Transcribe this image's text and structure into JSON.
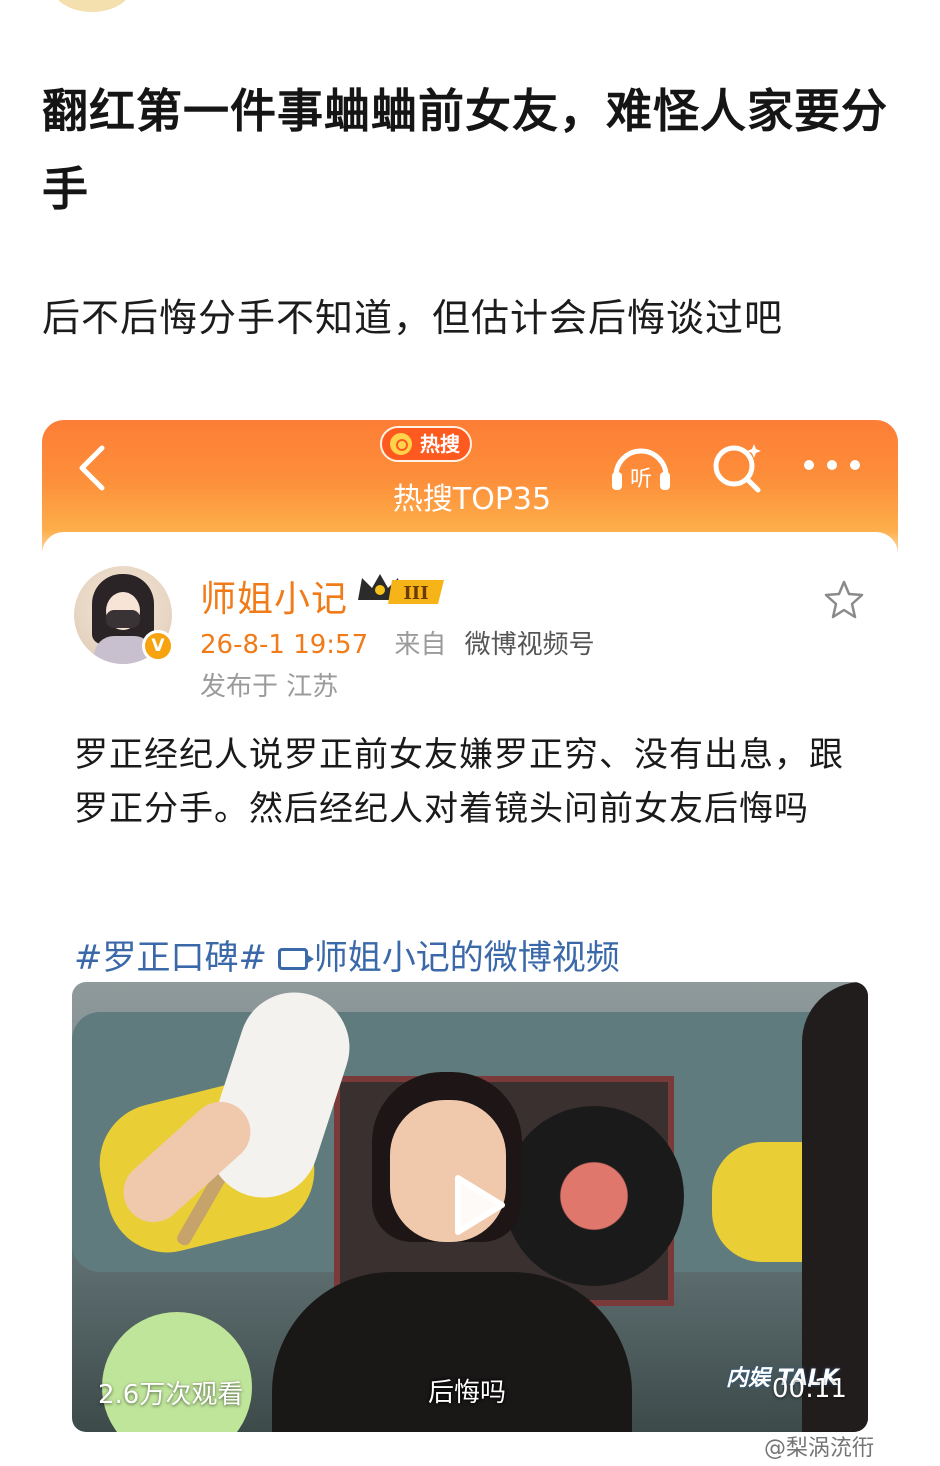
{
  "article": {
    "title": "翻红第一件事蛐蛐前女友，难怪人家要分手",
    "lead": "后不后悔分手不知道，但估计会后悔谈过吧"
  },
  "screenshot_card": {
    "header": {
      "badge": "热搜",
      "title": "热搜TOP35",
      "listen_label": "听"
    },
    "post": {
      "author": "师姐小记",
      "level_badge": "III",
      "verified_mark": "V",
      "time": "26-8-1 19:57",
      "source_prefix": "来自",
      "source": "微博视频号",
      "location": "发布于 江苏",
      "text": "罗正经纪人说罗正前女友嫌罗正穷、没有出息，跟罗正分手。然后经纪人对着镜头问前女友后悔吗",
      "hashtag": "#罗正口碑#",
      "video_link": "师姐小记的微博视频"
    },
    "video": {
      "view_count": "2.6万次观看",
      "subtitle": "后悔吗",
      "duration": "00:11",
      "show_logo": "内娱 TALK"
    }
  },
  "watermark": "@梨涡㳘衎",
  "colors": {
    "header_orange": "#fd7d36",
    "author_orange": "#f07b18",
    "link_blue": "#3a68a8",
    "hot_badge": "#fe5a20",
    "verified": "#f7a310"
  },
  "icons": [
    "back-icon",
    "headphone-icon",
    "search-icon",
    "more-icon",
    "star-icon",
    "crown-icon",
    "play-icon",
    "video-icon"
  ]
}
